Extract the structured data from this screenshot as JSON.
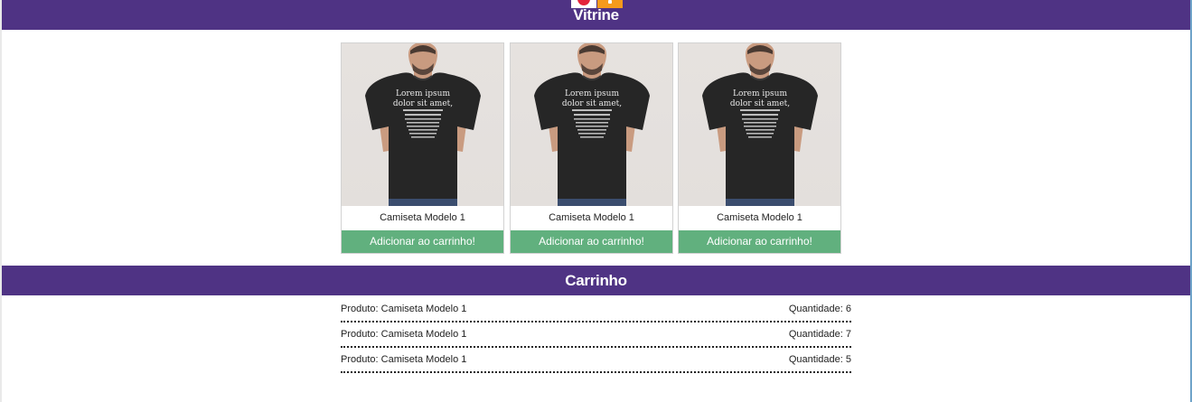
{
  "header": {
    "title": "Vitrine"
  },
  "products": [
    {
      "name": "Camiseta Modelo 1",
      "button_label": "Adicionar ao carrinho!",
      "image_icon": "tshirt-model-photo"
    },
    {
      "name": "Camiseta Modelo 1",
      "button_label": "Adicionar ao carrinho!",
      "image_icon": "tshirt-model-photo"
    },
    {
      "name": "Camiseta Modelo 1",
      "button_label": "Adicionar ao carrinho!",
      "image_icon": "tshirt-model-photo"
    }
  ],
  "cart": {
    "title": "Carrinho",
    "items": [
      {
        "product": "Produto: Camiseta Modelo 1",
        "quantity": "Quantidade: 6"
      },
      {
        "product": "Produto: Camiseta Modelo 1",
        "quantity": "Quantidade: 7"
      },
      {
        "product": "Produto: Camiseta Modelo 1",
        "quantity": "Quantidade: 5"
      }
    ]
  },
  "colors": {
    "header_bg": "#4f3384",
    "button_bg": "#61b07e",
    "logo_red": "#e4233a",
    "logo_orange": "#f59a1c"
  }
}
